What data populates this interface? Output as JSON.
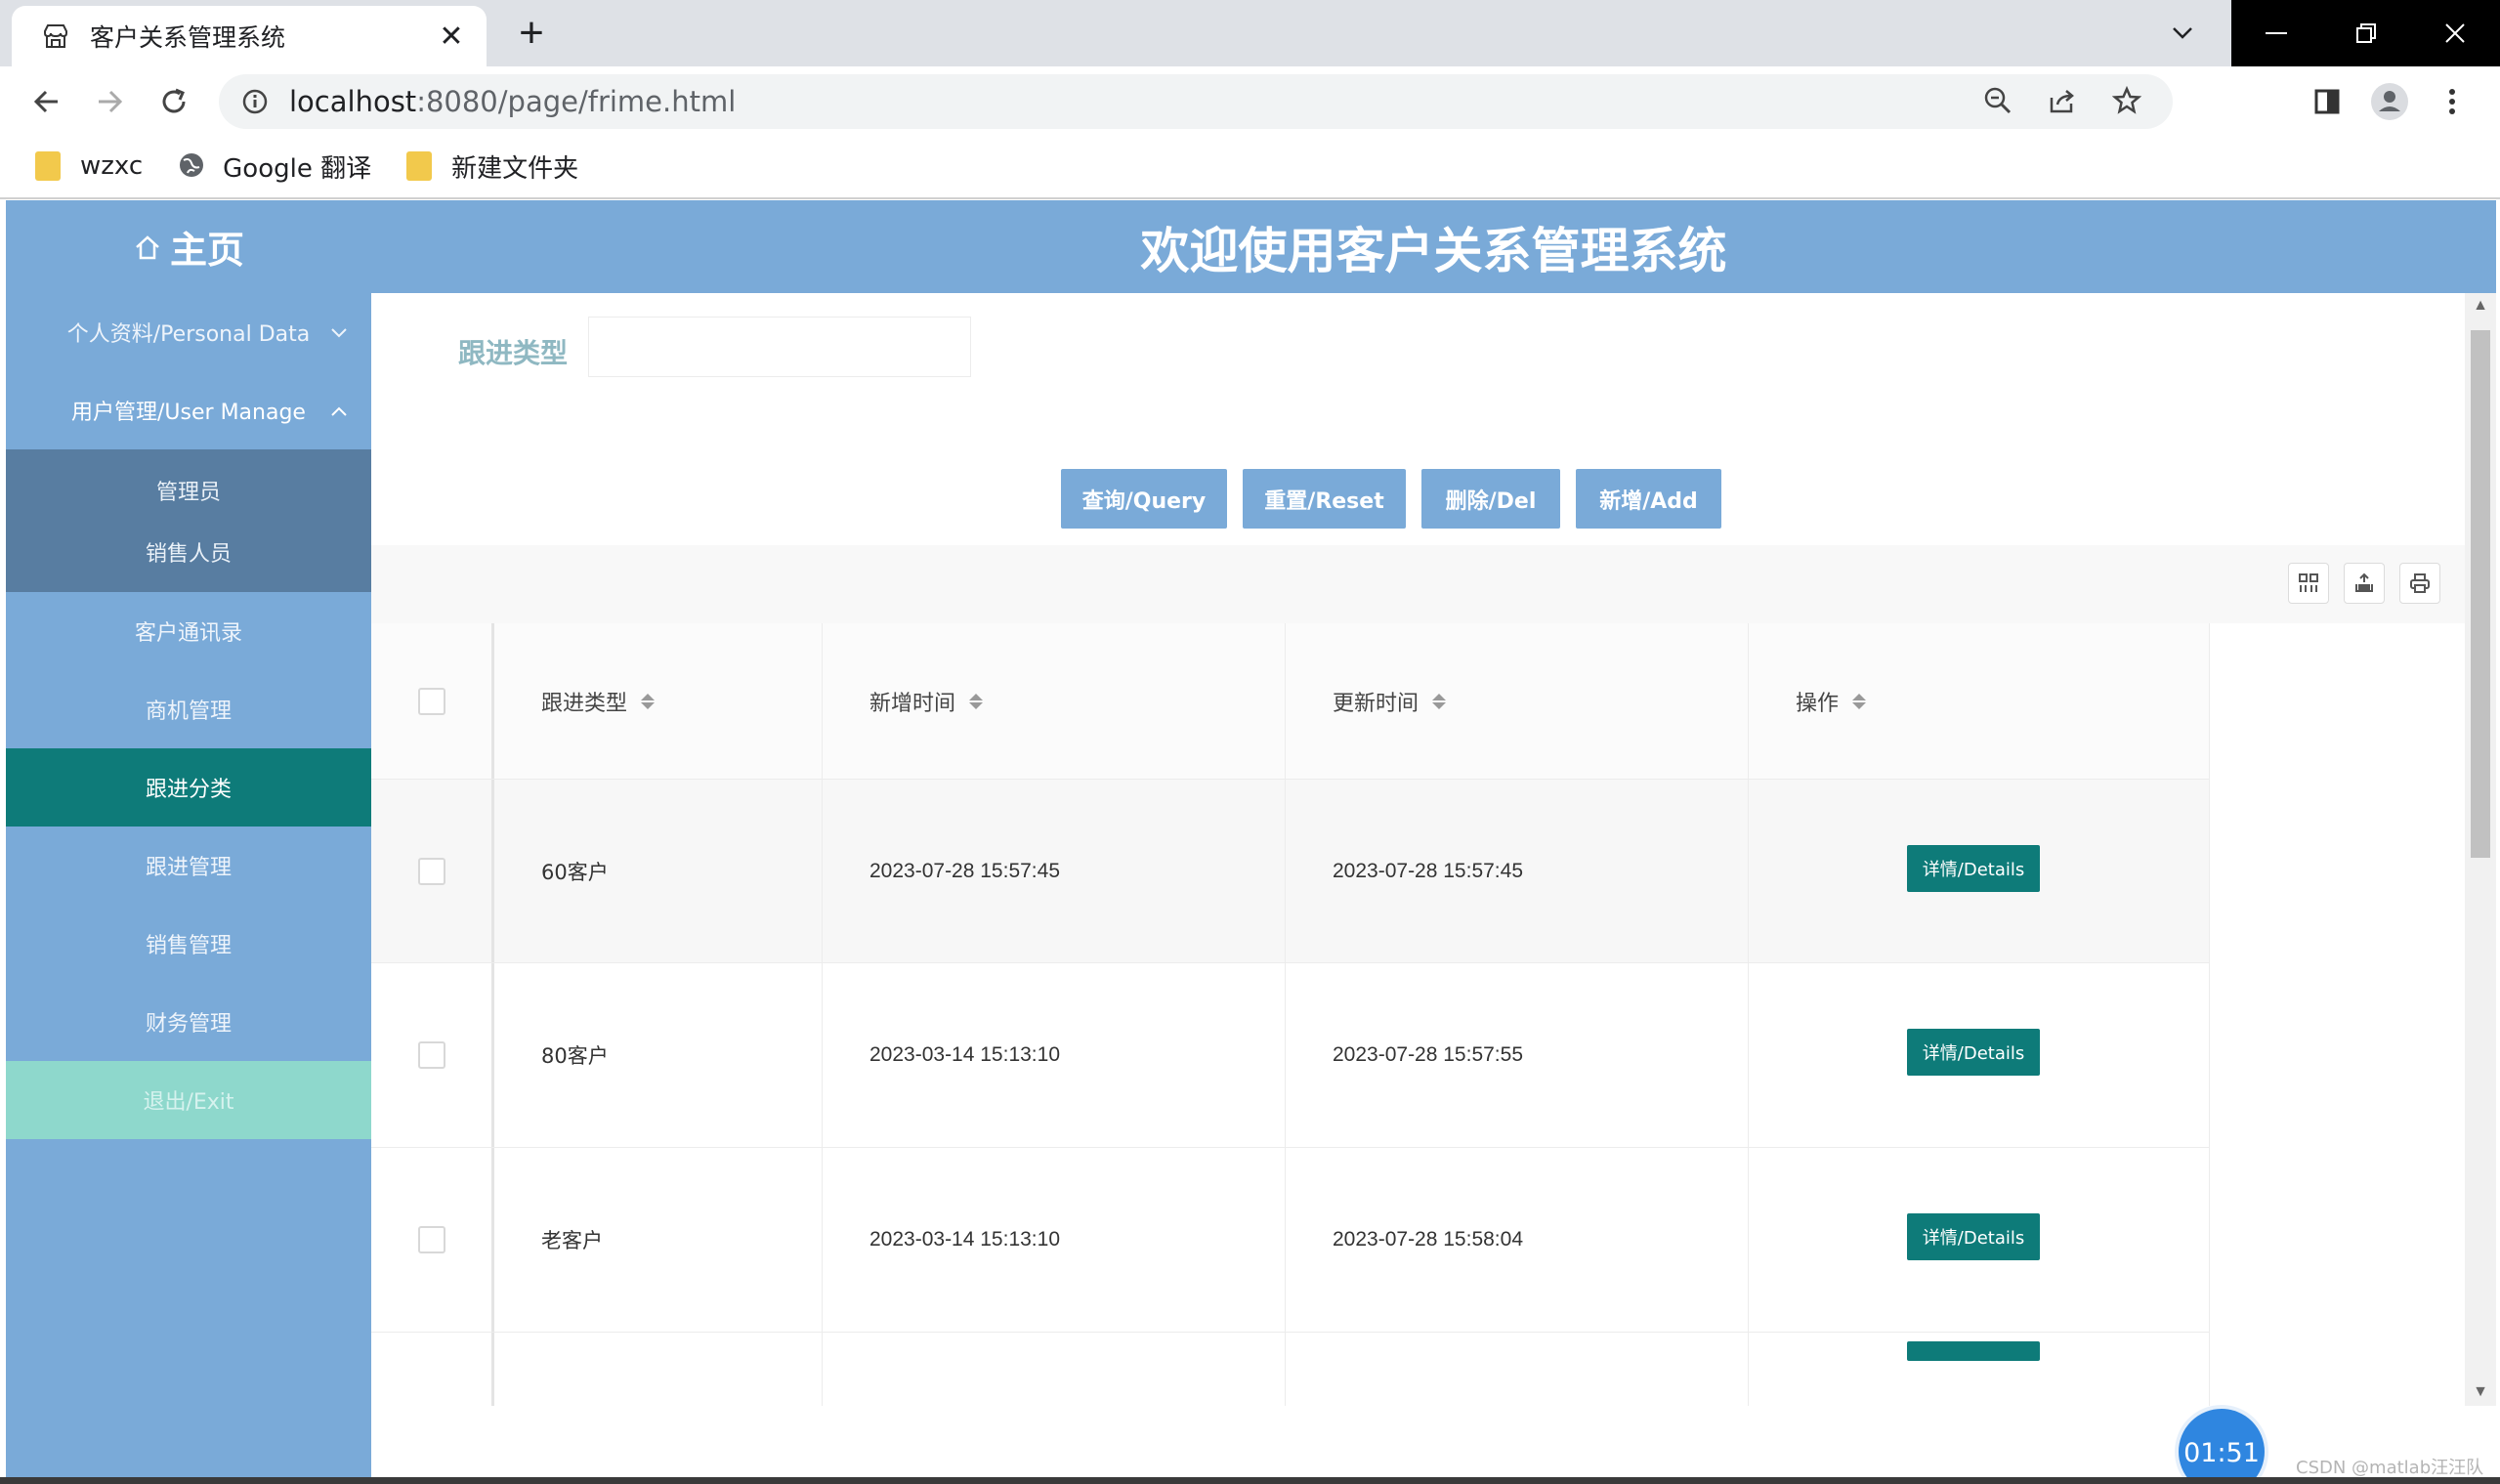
{
  "browser": {
    "tab_title": "客户关系管理系统",
    "url_host": "localhost",
    "url_path": ":8080/page/frime.html",
    "bookmarks": [
      {
        "label": "wzxc",
        "icon": "folder-icon"
      },
      {
        "label": "Google 翻译",
        "icon": "globe-icon"
      },
      {
        "label": "新建文件夹",
        "icon": "folder-icon"
      }
    ]
  },
  "header": {
    "home_label": "主页",
    "title": "欢迎使用客户关系管理系统"
  },
  "sidebar": {
    "items": [
      {
        "label": "个人资料/Personal Data"
      },
      {
        "label": "用户管理/User Manage"
      },
      {
        "label": "客户通讯录"
      },
      {
        "label": "商机管理"
      },
      {
        "label": "跟进分类"
      },
      {
        "label": "跟进管理"
      },
      {
        "label": "销售管理"
      },
      {
        "label": "财务管理"
      },
      {
        "label": "退出/Exit"
      }
    ],
    "submenu": [
      "管理员",
      "销售人员"
    ]
  },
  "search": {
    "label": "跟进类型",
    "value": ""
  },
  "buttons": {
    "query": "查询/Query",
    "reset": "重置/Reset",
    "del": "删除/Del",
    "add": "新增/Add"
  },
  "table": {
    "columns": [
      "跟进类型",
      "新增时间",
      "更新时间",
      "操作"
    ],
    "rows": [
      {
        "type": "60客户",
        "created": "2023-07-28 15:57:45",
        "updated": "2023-07-28 15:57:45",
        "action": "详情/Details"
      },
      {
        "type": "80客户",
        "created": "2023-03-14 15:13:10",
        "updated": "2023-07-28 15:57:55",
        "action": "详情/Details"
      },
      {
        "type": "老客户",
        "created": "2023-03-14 15:13:10",
        "updated": "2023-07-28 15:58:04",
        "action": "详情/Details"
      }
    ]
  },
  "overlay": {
    "timer": "01:51",
    "watermark": "CSDN @matlab汪汪队"
  },
  "colors": {
    "header_blue": "#7aaad8",
    "active_teal": "#0e7b79",
    "exit_mint": "#8ed8cc"
  }
}
